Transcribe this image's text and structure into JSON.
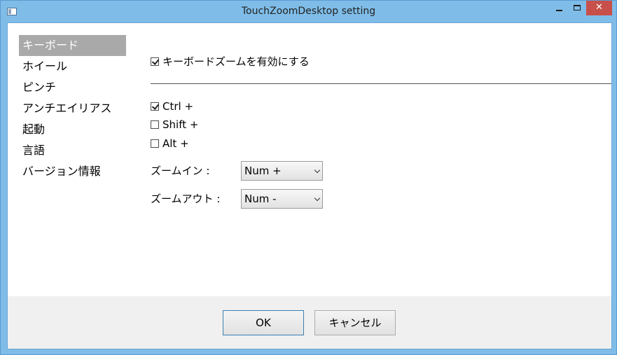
{
  "window": {
    "title": "TouchZoomDesktop setting"
  },
  "nav": {
    "items": [
      {
        "label": "キーボード",
        "selected": true
      },
      {
        "label": "ホイール",
        "selected": false
      },
      {
        "label": "ピンチ",
        "selected": false
      },
      {
        "label": "アンチエイリアス",
        "selected": false
      },
      {
        "label": "起動",
        "selected": false
      },
      {
        "label": "言語",
        "selected": false
      },
      {
        "label": "バージョン情報",
        "selected": false
      }
    ]
  },
  "keyboard": {
    "enable_label": "キーボードズームを有効にする",
    "enable_checked": true,
    "modifiers": [
      {
        "label": "Ctrl +",
        "checked": true
      },
      {
        "label": "Shift +",
        "checked": false
      },
      {
        "label": "Alt +",
        "checked": false
      }
    ],
    "zoom_in_label": "ズームイン :",
    "zoom_in_value": "Num +",
    "zoom_out_label": "ズームアウト :",
    "zoom_out_value": "Num -"
  },
  "footer": {
    "ok_label": "OK",
    "cancel_label": "キャンセル"
  }
}
